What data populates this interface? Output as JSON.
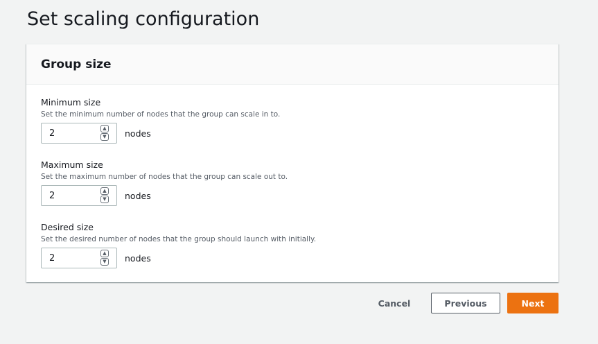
{
  "page": {
    "title": "Set scaling configuration"
  },
  "panel": {
    "title": "Group size",
    "fields": [
      {
        "label": "Minimum size",
        "description": "Set the minimum number of nodes that the group can scale in to.",
        "value": "2",
        "unit": "nodes"
      },
      {
        "label": "Maximum size",
        "description": "Set the maximum number of nodes that the group can scale out to.",
        "value": "2",
        "unit": "nodes"
      },
      {
        "label": "Desired size",
        "description": "Set the desired number of nodes that the group should launch with initially.",
        "value": "2",
        "unit": "nodes"
      }
    ]
  },
  "actions": {
    "cancel_label": "Cancel",
    "previous_label": "Previous",
    "next_label": "Next"
  },
  "colors": {
    "primary": "#ec7211",
    "background": "#f2f3f3",
    "text": "#16191f",
    "secondary_text": "#545b64"
  }
}
